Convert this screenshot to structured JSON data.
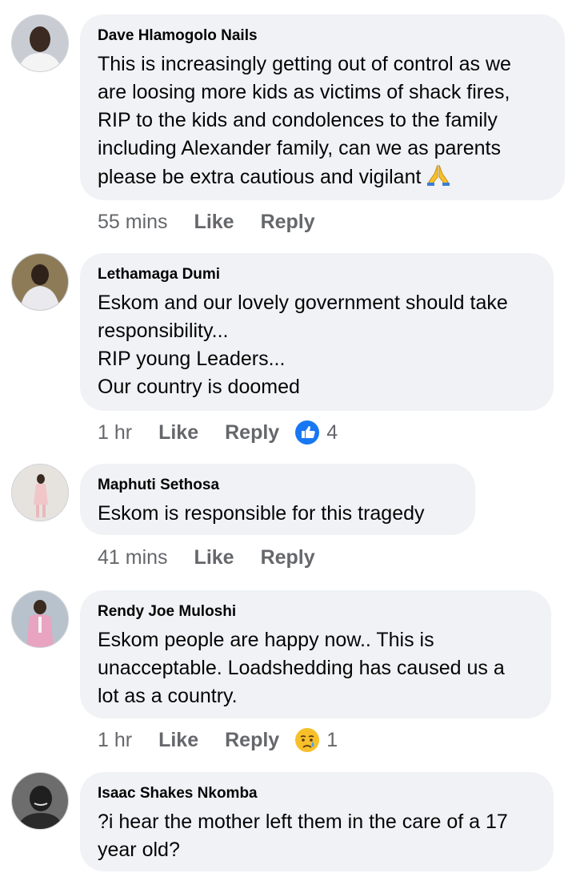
{
  "comments": [
    {
      "author": "Dave Hlamogolo Nails",
      "text": "This is increasingly getting out of control as we\nare loosing more kids as victims of shack fires,\nRIP to the kids and condolences to the family\nincluding Alexander family, can we as parents\nplease be extra cautious and vigilant",
      "time": "55 mins",
      "like": "Like",
      "reply": "Reply",
      "avatar_icon": "profile-photo"
    },
    {
      "author": "Lethamaga Dumi",
      "text": "Eskom and our lovely government should take\nresponsibility...\nRIP young Leaders...\nOur country is doomed",
      "time": "1 hr",
      "like": "Like",
      "reply": "Reply",
      "reaction_icon": "like-reaction-icon",
      "reaction_count": "4",
      "avatar_icon": "profile-photo"
    },
    {
      "author": "Maphuti Sethosa",
      "text": "Eskom is responsible  for this tragedy",
      "time": "41 mins",
      "like": "Like",
      "reply": "Reply",
      "avatar_icon": "profile-photo"
    },
    {
      "author": "Rendy Joe Muloshi",
      "text": "Eskom people are happy now.. This is\nunacceptable. Loadshedding has caused us a\nlot as a country.",
      "time": "1 hr",
      "like": "Like",
      "reply": "Reply",
      "reaction_icon": "sad-reaction-icon",
      "reaction_count": "1",
      "avatar_icon": "profile-photo"
    },
    {
      "author": "Isaac Shakes Nkomba",
      "text": "?i hear the mother left them in the care of a 17\nyear old?",
      "avatar_icon": "profile-photo"
    }
  ],
  "colors": {
    "bubble": "#f0f2f5",
    "meta_text": "#65676b",
    "like_blue": "#1877f2",
    "text": "#050505"
  }
}
